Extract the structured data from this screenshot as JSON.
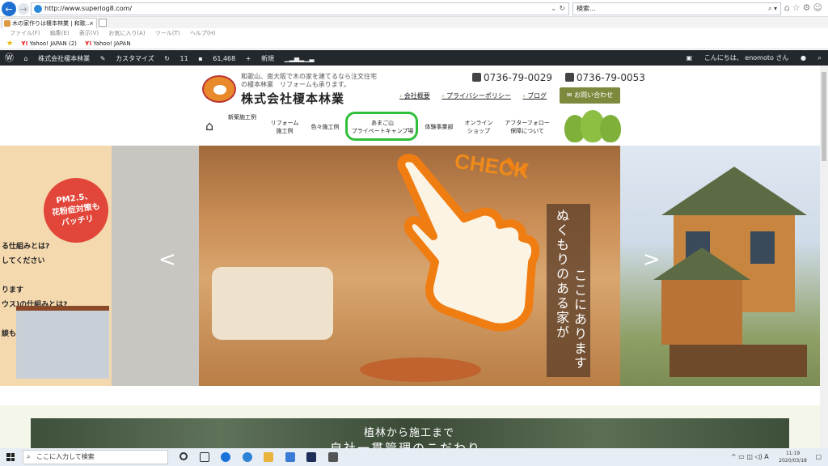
{
  "browser": {
    "url": "http://www.superlog8.com/",
    "search_placeholder": "検索...",
    "tab_title": "木の家作りは榎本林業 | 和歌...",
    "tab_close": "×",
    "menu": [
      "ファイル(F)",
      "編集(E)",
      "表示(V)",
      "お気に入り(A)",
      "ツール(T)",
      "ヘルプ(H)"
    ],
    "favorites": [
      "Yahoo! JAPAN (2)",
      "Yahoo! JAPAN"
    ],
    "yahoo_mark": "Y!"
  },
  "wpbar": {
    "site_name": "株式会社榎本林業",
    "customize": "カスタマイズ",
    "updates": "11",
    "comments": "61,468",
    "new": "新規",
    "greeting": "こんにちは、 enomoto さん"
  },
  "site": {
    "tagline_1": "和歌山、南大阪で木の家を建てるなら注文住宅",
    "tagline_2": "の榎本林業　リフォームも承ります。",
    "company": "株式会社榎本林業",
    "phone_1": "0736-79-0029",
    "phone_2": "0736-79-0053",
    "sublinks": [
      "会社概要",
      "プライバシーポリシー",
      "ブログ"
    ],
    "contact": "お問い合わせ",
    "nav": [
      {
        "label": "新築施工例"
      },
      {
        "label": "リフォーム\n施工例"
      },
      {
        "label": "色々施工例"
      },
      {
        "label": "あまご山\nプライベートキャンプ場"
      },
      {
        "label": "体験事業部"
      },
      {
        "label": "オンライン\nショップ"
      },
      {
        "label": "アフターフォロー\n保障について"
      }
    ]
  },
  "hero": {
    "pm_badge": "PM2.5、\n花粉症対策も\nバッチリ",
    "left_partial": "る仕組みとは?\nしてください\n\nります\nウス)の仕組みとは?\n\n談も",
    "prev": "<",
    "next": ">",
    "check": "CHECK",
    "vertical_col1": "ぬくもりのある家が",
    "vertical_col2": "ここにあります"
  },
  "band": {
    "line1": "植林から施工まで",
    "line2": "自社一貫管理のこだわり"
  },
  "taskbar": {
    "search": "ここに入力して検索",
    "time": "11:19",
    "date": "2020/03/18",
    "ime": "A"
  }
}
